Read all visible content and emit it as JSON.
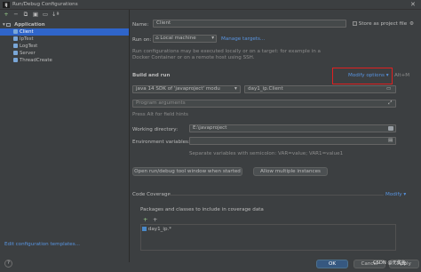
{
  "window": {
    "app_icon": "IJ",
    "title": "Run/Debug Configurations",
    "close": "✕"
  },
  "toolbar": {
    "icons": [
      "plus-icon",
      "minus-icon",
      "copy-icon",
      "save-icon",
      "folder-icon",
      "sort-icon"
    ],
    "glyphs": [
      "+",
      "−",
      "⧉",
      "▣",
      "▭",
      "↓ª"
    ]
  },
  "tree": {
    "root": {
      "label": "Application",
      "expanded": true
    },
    "items": [
      {
        "label": "Client",
        "selected": true
      },
      {
        "label": "IpTest"
      },
      {
        "label": "LogTest"
      },
      {
        "label": "Server"
      },
      {
        "label": "ThreadCreate"
      }
    ],
    "edit_templates_link": "Edit configuration templates..."
  },
  "form": {
    "name_label": "Name:",
    "name_value": "Client",
    "store_project_file": "Store as project file",
    "run_on_label": "Run on:",
    "run_on_value": "Local machine",
    "manage_targets": "Manage targets...",
    "run_on_hint": "Run configurations may be executed locally or on a target: for example in a Docker Container or on a remote host using SSH.",
    "build_run_title": "Build and run",
    "modify_options": "Modify options",
    "modify_options_shortcut": "Alt+M",
    "jdk_value": "java 14  SDK of 'javaproject' modu",
    "main_class_value": "day1_ip.Client",
    "program_args_placeholder": "Program arguments",
    "program_args_hint": "Press Alt for field hints",
    "working_dir_label": "Working directory:",
    "working_dir_value": "E:\\javaproject",
    "env_vars_label": "Environment variables:",
    "env_vars_hint": "Separate variables with semicolon: VAR=value; VAR1=value1",
    "open_tool_window_btn": "Open run/debug tool window when started",
    "allow_multiple_btn": "Allow multiple instances",
    "code_coverage_title": "Code Coverage",
    "modify_link": "Modify",
    "coverage_packages_label": "Packages and classes to include in coverage data",
    "coverage_item": "day1_ip.*"
  },
  "footer": {
    "help": "?",
    "ok": "OK",
    "cancel": "Cancel",
    "apply": "Apply",
    "watermark": "CSDN @无优鱼"
  },
  "colors": {
    "background": "#3c3f41",
    "selection": "#2f65ca",
    "link": "#5894e0",
    "highlight_box": "#e02020",
    "ok_button": "#365880"
  }
}
